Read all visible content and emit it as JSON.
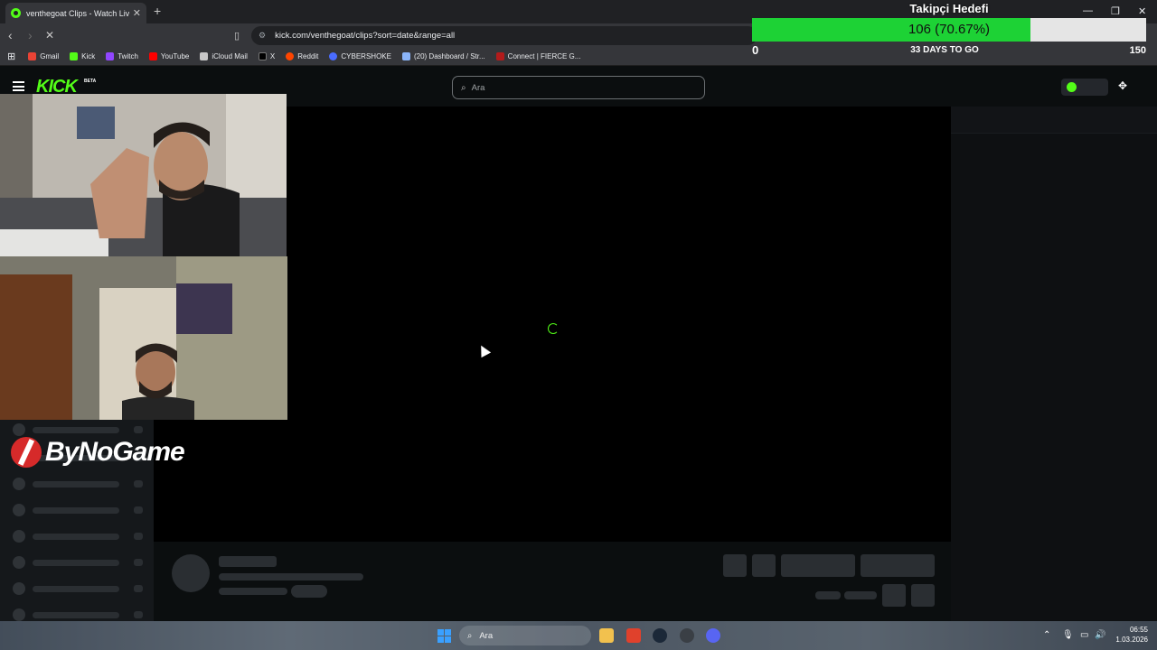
{
  "browser": {
    "tab_title": "venthegoat Clips - Watch Live o",
    "tab_close": "✕",
    "new_tab": "+",
    "url": "kick.com/venthegoat/clips?sort=date&range=all",
    "bookmarks": [
      {
        "label": "Gmail",
        "color": "#ea4335"
      },
      {
        "label": "Kick",
        "color": "#53fc18"
      },
      {
        "label": "Twitch",
        "color": "#9146ff"
      },
      {
        "label": "YouTube",
        "color": "#ff0000"
      },
      {
        "label": "iCloud Mail",
        "color": "#c8c8c8"
      },
      {
        "label": "X",
        "color": "#000000"
      },
      {
        "label": "Reddit",
        "color": "#ff4500"
      },
      {
        "label": "CYBERSHOKE",
        "color": "#4a6cff"
      },
      {
        "label": "(20) Dashboard / Str...",
        "color": "#8ab4f8"
      },
      {
        "label": "Connect | FIERCE G...",
        "color": "#b31b1b"
      }
    ]
  },
  "goal": {
    "title": "Takipçi Hedefi",
    "value_text": "106 (70.67%)",
    "progress": 0.7067,
    "min": "0",
    "max": "150",
    "days": "33 DAYS TO GO"
  },
  "kick": {
    "logo": "KICK",
    "beta": "BETA",
    "search_placeholder": "Ara"
  },
  "overlay": {
    "sponsor": "ByNoGame"
  },
  "taskbar": {
    "search_placeholder": "Ara",
    "time": "06:55",
    "date": "1.03.2026"
  }
}
